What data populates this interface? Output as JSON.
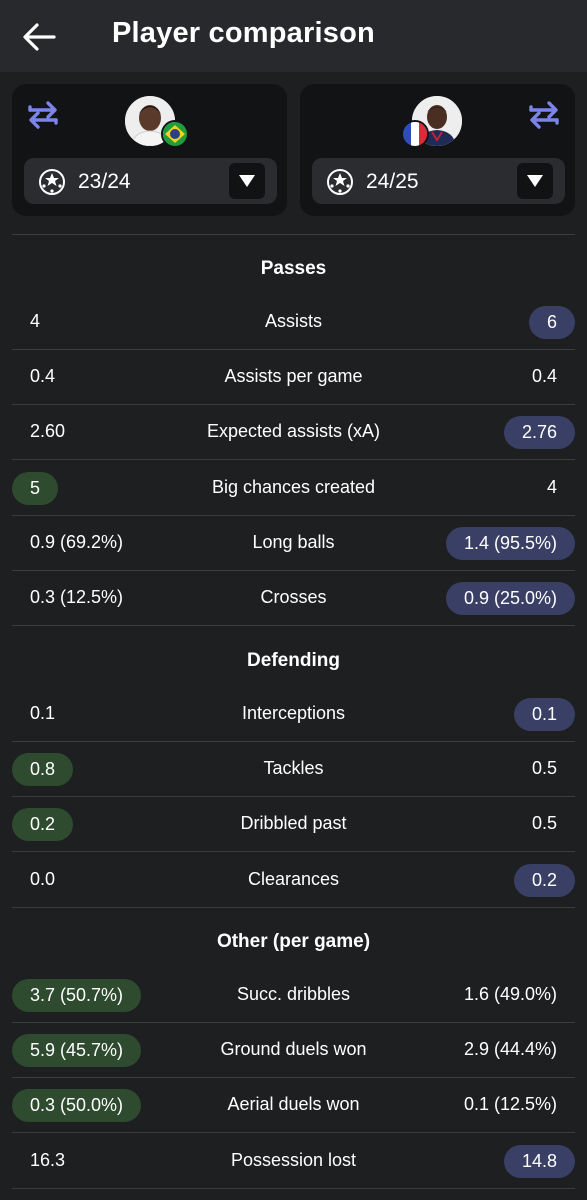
{
  "header": {
    "title": "Player comparison",
    "back_icon": "arrow-left-icon"
  },
  "players": {
    "left": {
      "season": "23/24",
      "nationality_flag": "brazil-flag"
    },
    "right": {
      "season": "24/25",
      "nationality_flag": "france-flag"
    }
  },
  "colors": {
    "left_highlight": "#2e4a2f",
    "right_highlight": "#3a3f66",
    "accent_icon": "#7b84e8"
  },
  "sections": [
    {
      "title": "Passes",
      "rows": [
        {
          "label": "Assists",
          "left": "4",
          "right": "6",
          "winner": "right"
        },
        {
          "label": "Assists per game",
          "left": "0.4",
          "right": "0.4",
          "winner": "none"
        },
        {
          "label": "Expected assists (xA)",
          "left": "2.60",
          "right": "2.76",
          "winner": "right"
        },
        {
          "label": "Big chances created",
          "left": "5",
          "right": "4",
          "winner": "left"
        },
        {
          "label": "Long balls",
          "left": "0.9 (69.2%)",
          "right": "1.4 (95.5%)",
          "winner": "right"
        },
        {
          "label": "Crosses",
          "left": "0.3 (12.5%)",
          "right": "0.9 (25.0%)",
          "winner": "right"
        }
      ]
    },
    {
      "title": "Defending",
      "rows": [
        {
          "label": "Interceptions",
          "left": "0.1",
          "right": "0.1",
          "winner": "right"
        },
        {
          "label": "Tackles",
          "left": "0.8",
          "right": "0.5",
          "winner": "left"
        },
        {
          "label": "Dribbled past",
          "left": "0.2",
          "right": "0.5",
          "winner": "left"
        },
        {
          "label": "Clearances",
          "left": "0.0",
          "right": "0.2",
          "winner": "right"
        }
      ]
    },
    {
      "title": "Other (per game)",
      "rows": [
        {
          "label": "Succ. dribbles",
          "left": "3.7 (50.7%)",
          "right": "1.6 (49.0%)",
          "winner": "left"
        },
        {
          "label": "Ground duels won",
          "left": "5.9 (45.7%)",
          "right": "2.9 (44.4%)",
          "winner": "left"
        },
        {
          "label": "Aerial duels won",
          "left": "0.3 (50.0%)",
          "right": "0.1 (12.5%)",
          "winner": "left"
        },
        {
          "label": "Possession lost",
          "left": "16.3",
          "right": "14.8",
          "winner": "right"
        }
      ]
    }
  ]
}
